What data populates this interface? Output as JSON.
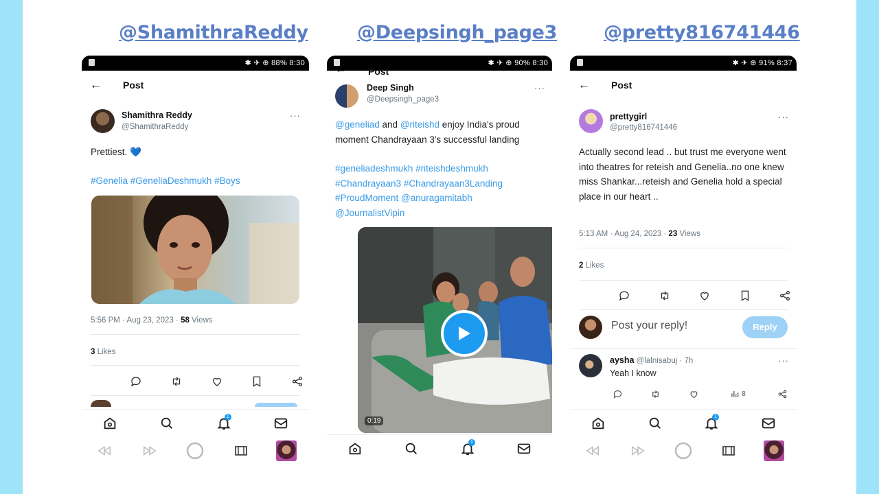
{
  "handles": [
    "@ShamithraReddy",
    "@Deepsingh_page3",
    "@pretty816741446"
  ],
  "phone1": {
    "status": "✱ ✈ ⊕ 88% 8:30",
    "header_title": "Post",
    "author_name": "Shamithra Reddy",
    "author_handle": "@ShamithraReddy",
    "text_line1": "Prettiest. ",
    "heart_emoji": "💙",
    "hashtags": "#Genelia #GeneliaDeshmukh #Boys",
    "timestamp": "5:56 PM · Aug 23, 2023 · ",
    "views_count": "58",
    "views_label": " Views",
    "likes_count": "3",
    "likes_label": " Likes"
  },
  "phone2": {
    "status": "✱ ✈ ⊕ 90% 8:30",
    "header_title": "Post",
    "author_name": "Deep Singh",
    "author_handle": "@Deepsingh_page3",
    "mention1": "@geneliad",
    "and_word": " and ",
    "mention2": "@riteishd",
    "text_rest": " enjoy India's proud moment Chandrayaan 3's successful landing",
    "tags": "#geneliadeshmukh #riteishdeshmukh #Chandrayaan3 #Chandrayaan3Landing #ProudMoment @anuragamitabh @JournalistVipin",
    "video_duration": "0:19"
  },
  "phone3": {
    "status": "✱ ✈ ⊕ 91% 8:37",
    "header_title": "Post",
    "author_name": "prettygirl",
    "author_handle": "@pretty816741446",
    "text": "Actually second lead .. but trust me everyone went into theatres for reteish and Genelia..no one knew miss Shankar...reteish and Genelia hold a special place in our heart ..",
    "timestamp": "5:13 AM · Aug 24, 2023 · ",
    "views_count": "23",
    "views_label": " Views",
    "likes_count": "2",
    "likes_label": " Likes",
    "reply_placeholder": "Post your reply!",
    "reply_button": "Reply",
    "reply_author": "aysha",
    "reply_handle": " @lalnisabuj · 7h",
    "reply_text": "Yeah I know",
    "reply_views": "8"
  },
  "nav_badge": "1",
  "colors": {
    "accent": "#1d9bf0",
    "handle": "#5a7fc7",
    "page_bg": "#9ee3f7"
  }
}
